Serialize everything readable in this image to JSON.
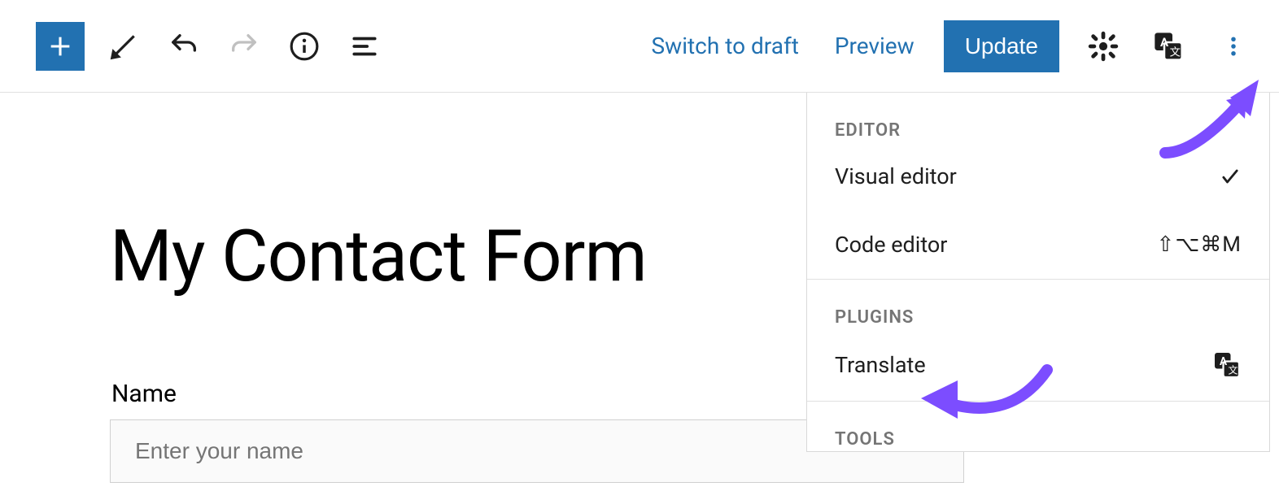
{
  "toolbar": {
    "switch_to_draft": "Switch to draft",
    "preview": "Preview",
    "update": "Update"
  },
  "page": {
    "title": "My Contact Form",
    "field_label": "Name",
    "field_placeholder": "Enter your name"
  },
  "dropdown": {
    "section_editor": "EDITOR",
    "visual_editor": "Visual editor",
    "code_editor": "Code editor",
    "code_editor_shortcut": "⇧⌥⌘M",
    "section_plugins": "PLUGINS",
    "translate": "Translate",
    "section_tools": "TOOLS"
  }
}
